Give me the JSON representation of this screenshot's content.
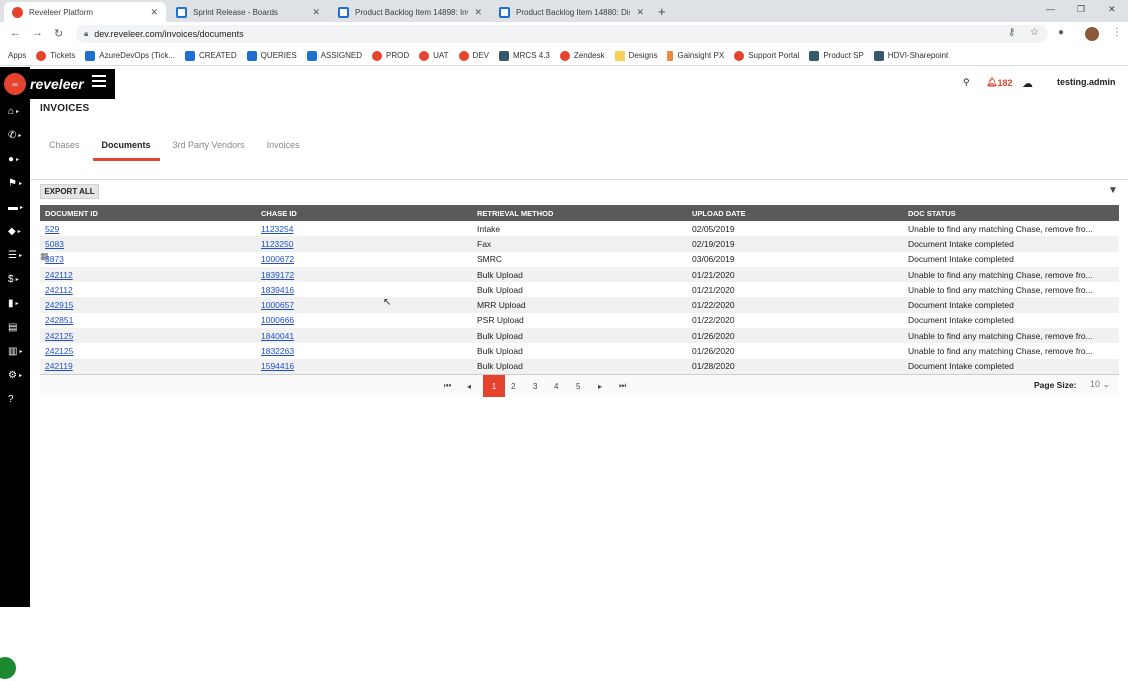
{
  "browser": {
    "tabs": [
      {
        "title": "Reveleer Platform",
        "icon": "reveleer-icon",
        "active": true
      },
      {
        "title": "Sprint Release - Boards",
        "icon": "azure-devops-icon",
        "active": false
      },
      {
        "title": "Product Backlog Item 14898: Inv...",
        "icon": "azure-devops-icon",
        "active": false
      },
      {
        "title": "Product Backlog Item 14880: Dis...",
        "icon": "azure-devops-icon",
        "active": false
      }
    ],
    "url": "dev.reveleer.com/invoices/documents",
    "bookmarks": [
      {
        "label": "Apps",
        "icon": "apps-grid-icon"
      },
      {
        "label": "Tickets",
        "icon": "reveleer-icon"
      },
      {
        "label": "AzureDevOps (Tick...",
        "icon": "azure-devops-icon"
      },
      {
        "label": "CREATED",
        "icon": "azure-devops-icon"
      },
      {
        "label": "QUERIES",
        "icon": "azure-devops-icon"
      },
      {
        "label": "ASSIGNED",
        "icon": "azure-devops-icon"
      },
      {
        "label": "PROD",
        "icon": "reveleer-icon"
      },
      {
        "label": "UAT",
        "icon": "reveleer-icon"
      },
      {
        "label": "DEV",
        "icon": "reveleer-icon"
      },
      {
        "label": "MRCS 4.3",
        "icon": "bookmark-icon"
      },
      {
        "label": "Zendesk",
        "icon": "reveleer-icon"
      },
      {
        "label": "Designs",
        "icon": "folder-icon"
      },
      {
        "label": "Gainsight PX",
        "icon": "gainsight-icon"
      },
      {
        "label": "Support Portal",
        "icon": "reveleer-icon"
      },
      {
        "label": "Product SP",
        "icon": "sharepoint-icon"
      },
      {
        "label": "HDVI-Sharepoint",
        "icon": "sharepoint-icon"
      }
    ]
  },
  "header": {
    "logo_text": "reveleer",
    "notification_count": "182",
    "username": "testing.admin"
  },
  "page": {
    "title": "INVOICES",
    "tabs": [
      "Chases",
      "Documents",
      "3rd Party Vendors",
      "Invoices"
    ],
    "active_tab": "Documents",
    "export_label": "EXPORT ALL"
  },
  "grid": {
    "columns": [
      "DOCUMENT ID",
      "CHASE ID",
      "RETRIEVAL METHOD",
      "UPLOAD DATE",
      "DOC STATUS"
    ],
    "rows": [
      [
        "529",
        "1123254",
        "Intake",
        "02/05/2019",
        "Unable to find any matching Chase, remove fro..."
      ],
      [
        "5083",
        "1123250",
        "Fax",
        "02/19/2019",
        "Document Intake completed"
      ],
      [
        "3873",
        "1000672",
        "SMRC",
        "03/06/2019",
        "Document Intake completed"
      ],
      [
        "242112",
        "1839172",
        "Bulk Upload",
        "01/21/2020",
        "Unable to find any matching Chase, remove fro..."
      ],
      [
        "242112",
        "1839416",
        "Bulk Upload",
        "01/21/2020",
        "Unable to find any matching Chase, remove fro..."
      ],
      [
        "242915",
        "1000657",
        "MRR Upload",
        "01/22/2020",
        "Document Intake completed"
      ],
      [
        "242851",
        "1000666",
        "PSR Upload",
        "01/22/2020",
        "Document Intake completed"
      ],
      [
        "242125",
        "1840041",
        "Bulk Upload",
        "01/26/2020",
        "Unable to find any matching Chase, remove fro..."
      ],
      [
        "242125",
        "1832263",
        "Bulk Upload",
        "01/26/2020",
        "Unable to find any matching Chase, remove fro..."
      ],
      [
        "242119",
        "1594416",
        "Bulk Upload",
        "01/28/2020",
        "Document Intake completed"
      ]
    ]
  },
  "pager": {
    "pages": [
      "1",
      "2",
      "3",
      "4",
      "5"
    ],
    "current": "1",
    "page_size_label": "Page Size:",
    "page_size": "10"
  },
  "colors": {
    "accent": "#e5432e",
    "header_bg": "#5a5a5a",
    "sidebar_bg": "#000000"
  }
}
